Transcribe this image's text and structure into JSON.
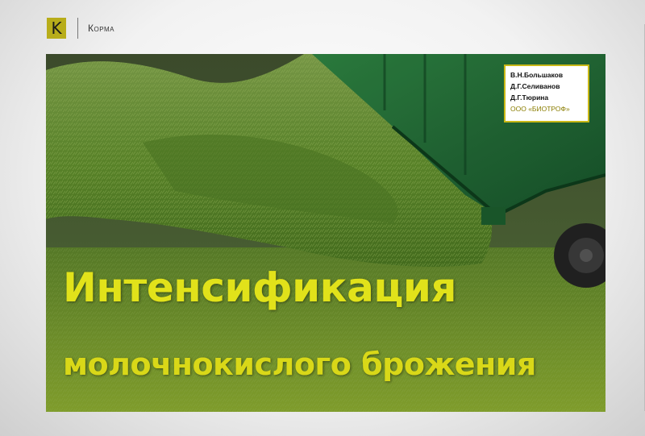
{
  "header": {
    "logo_letter": "K",
    "section": "Корма"
  },
  "hero": {
    "image_subject": "green silage being unloaded from a green truck trailer",
    "colors": {
      "grass": "#6e8e2f",
      "trailer": "#1f6a2e",
      "title": "#e1e21a",
      "author_border": "#c9b817"
    }
  },
  "authors": {
    "names": [
      "В.Н.Большаков",
      "Д.Г.Селиванов",
      "Д.Г.Тюрина"
    ],
    "organization": "ООО «БИОТРОФ»"
  },
  "article": {
    "title": "Интенсификация",
    "subtitle": "молочнокислого брожения"
  }
}
